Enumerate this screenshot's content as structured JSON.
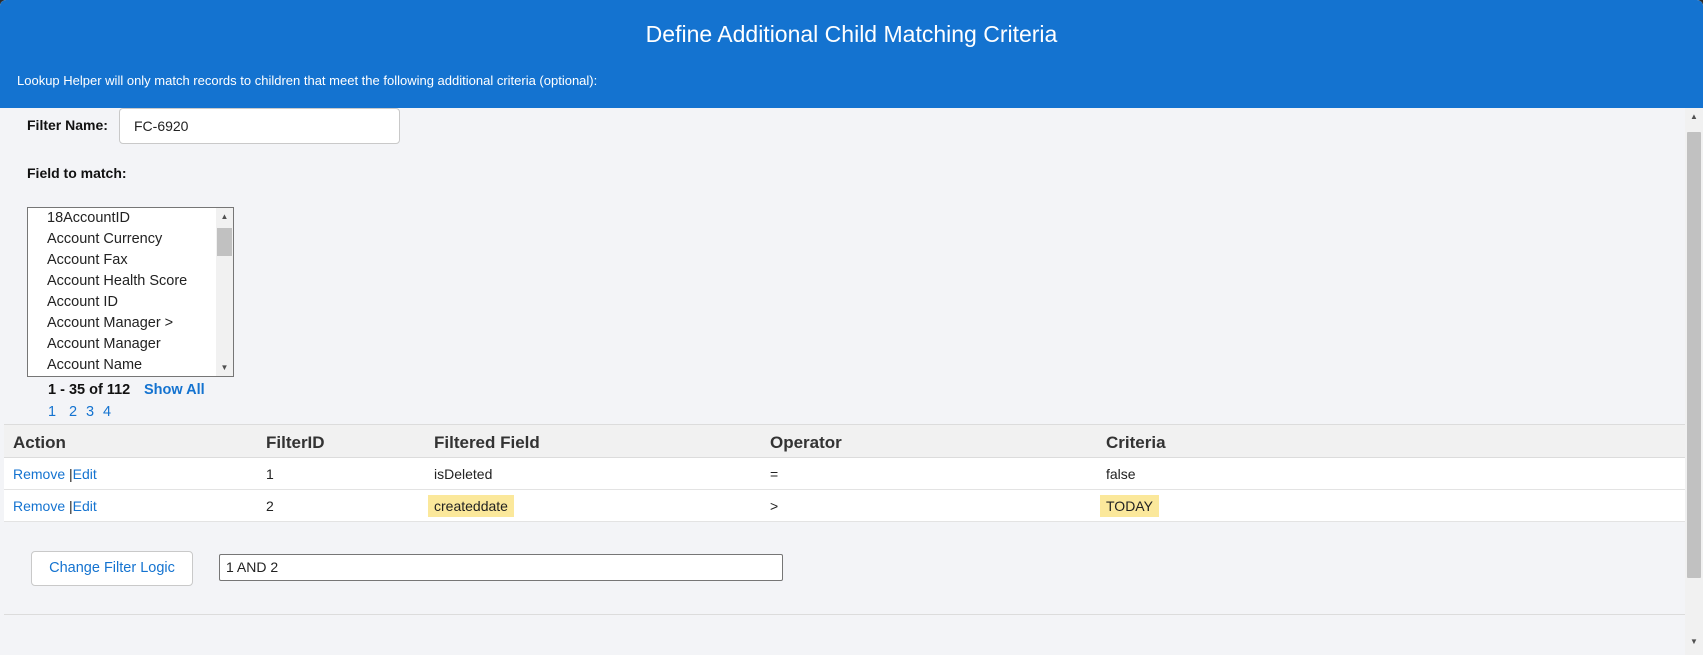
{
  "header": {
    "title": "Define Additional Child Matching Criteria",
    "subtitle": "Lookup Helper will only match records to children that meet the following additional criteria (optional):"
  },
  "filter_name": {
    "label": "Filter Name:",
    "value": "FC-6920"
  },
  "field_to_match": {
    "label": "Field to match:",
    "options": [
      "18AccountID",
      "Account Currency",
      "Account Fax",
      "Account Health Score",
      "Account ID",
      "Account Manager >",
      "Account Manager",
      "Account Name"
    ]
  },
  "pager": {
    "count": "1 - 35 of 112",
    "show_all": "Show All",
    "pages": [
      "1",
      "2",
      "3",
      "4"
    ]
  },
  "table": {
    "headers": [
      "Action",
      "FilterID",
      "Filtered Field",
      "Operator",
      "Criteria"
    ],
    "rows": [
      {
        "remove": "Remove",
        "sep": "|",
        "edit": "Edit",
        "id": "1",
        "field": "isDeleted",
        "operator": "=",
        "criteria": "false"
      },
      {
        "remove": "Remove",
        "sep": "|",
        "edit": "Edit",
        "id": "2",
        "field": "createddate",
        "operator": ">",
        "criteria": "TODAY"
      }
    ]
  },
  "filter_logic": {
    "button_label": "Change Filter Logic",
    "value": "1 AND 2"
  },
  "icons": {
    "scroll_up": "▲",
    "scroll_down": "▼"
  },
  "colors": {
    "header_bg": "#1473d0",
    "link": "#1473d0",
    "highlight": "#fbe89b"
  }
}
